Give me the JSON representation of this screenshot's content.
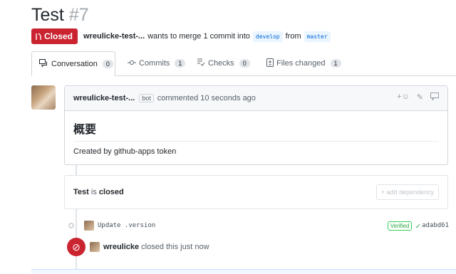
{
  "pr": {
    "title": "Test",
    "number": "#7",
    "state": "Closed",
    "author": "wreulicke-test-...",
    "merge_text": "wants to merge 1 commit into",
    "base_branch": "develop",
    "from_text": "from",
    "head_branch": "master"
  },
  "tabs": [
    {
      "label": "Conversation",
      "count": "0"
    },
    {
      "label": "Commits",
      "count": "1"
    },
    {
      "label": "Checks",
      "count": "0"
    },
    {
      "label": "Files changed",
      "count": "1"
    }
  ],
  "comment": {
    "author": "wreulicke-test-...",
    "badge": "bot",
    "meta": "commented 10 seconds ago",
    "heading": "概要",
    "body": "Created by github-apps token"
  },
  "closed_box": {
    "title": "Test",
    "suffix_is": "is",
    "suffix_closed": "closed",
    "add_dependency": "+ add dependency"
  },
  "commit": {
    "message": "Update .version",
    "verified": "Verified",
    "sha": "adabd61"
  },
  "event": {
    "actor": "wreulicke",
    "text": "closed this just now"
  },
  "colors": {
    "closed": "#cb2431",
    "link": "#0366d6",
    "verified": "#28a745"
  }
}
